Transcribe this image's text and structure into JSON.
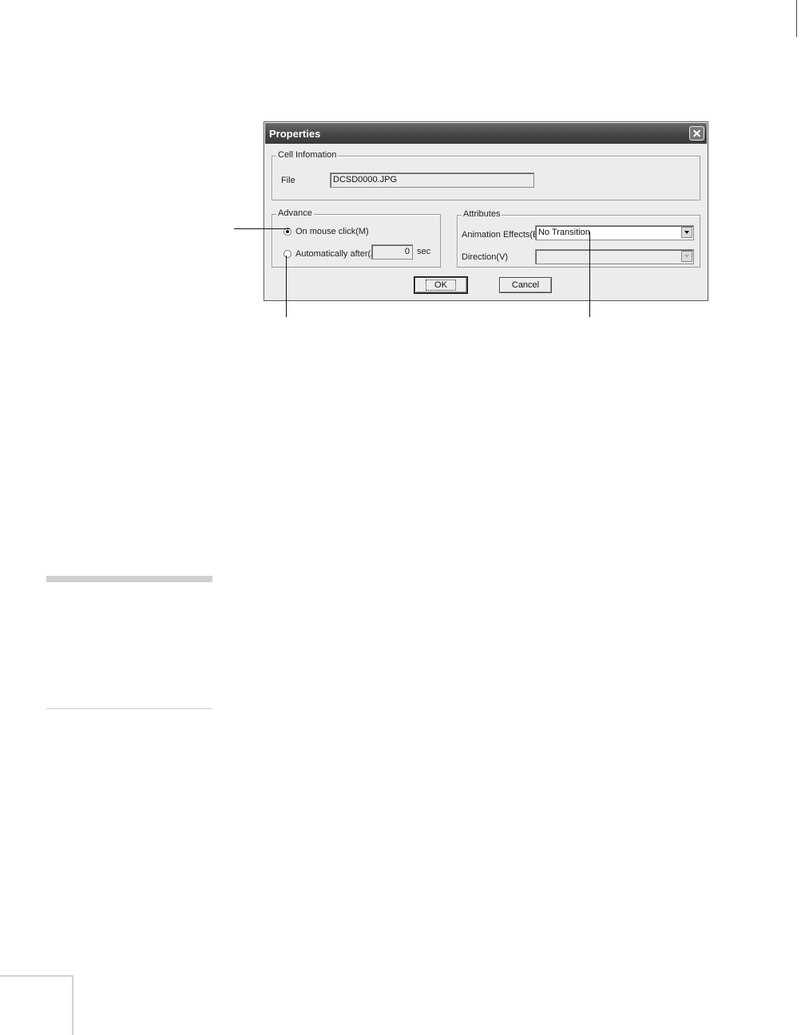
{
  "dialog": {
    "title": "Properties",
    "cell_info": {
      "group_label": "Cell Infomation",
      "file_label": "File",
      "file_value": "DCSD0000.JPG"
    },
    "advance": {
      "group_label": "Advance",
      "option_mouse": "On mouse click(M)",
      "option_auto": "Automatically after(A):",
      "auto_value": "0",
      "auto_unit": "sec",
      "selected": "On mouse click(M)"
    },
    "attributes": {
      "group_label": "Attributes",
      "animation_label": "Animation Effects(E):",
      "animation_value": "No Transition",
      "direction_label": "Direction(V)",
      "direction_value": ""
    },
    "buttons": {
      "ok": "OK",
      "cancel": "Cancel"
    }
  },
  "icons": {
    "close": "close-icon",
    "dropdown": "chevron-down-icon"
  }
}
